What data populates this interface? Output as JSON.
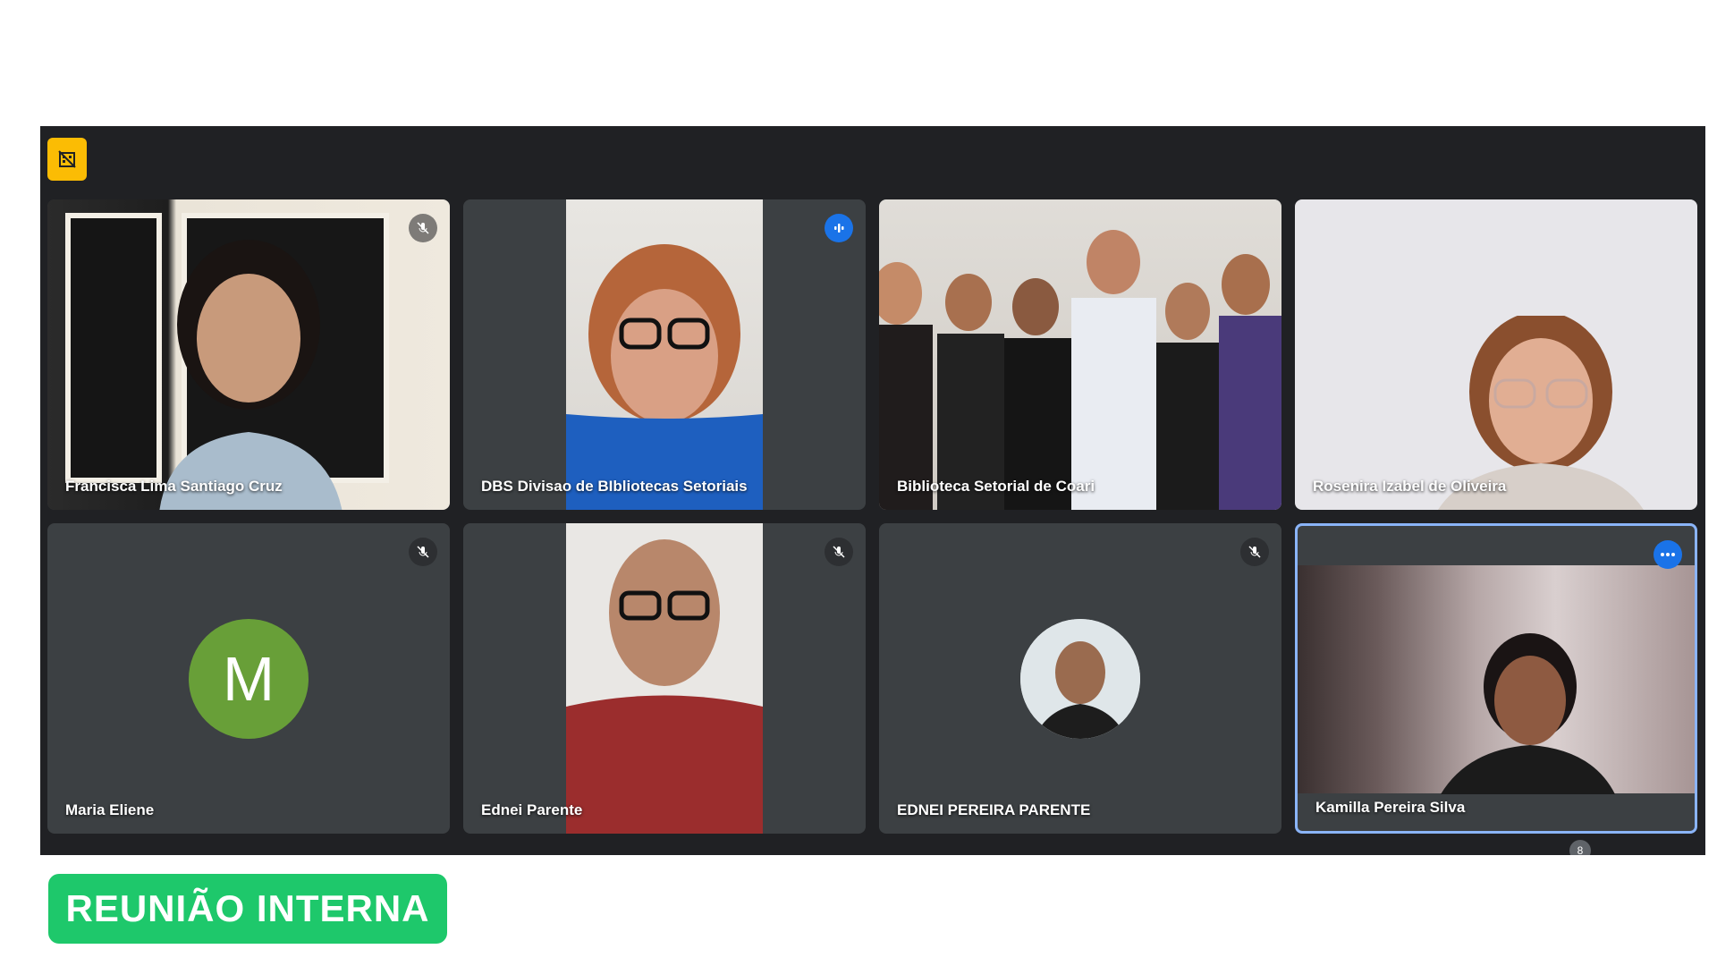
{
  "participant_count": "8",
  "banner": {
    "label": "REUNIÃO INTERNA",
    "color": "#1ec86b"
  },
  "accent": "#1a73e8",
  "participants": [
    {
      "name": "Francisca Lima Santiago Cruz",
      "status": "muted"
    },
    {
      "name": "DBS Divisao de BIbliotecas Setoriais",
      "status": "speaking"
    },
    {
      "name": "Biblioteca Setorial de Coari",
      "status": "none"
    },
    {
      "name": "Rosenira Izabel de Oliveira",
      "status": "none"
    },
    {
      "name": "Maria Eliene",
      "status": "muted",
      "avatar_letter": "M"
    },
    {
      "name": "Ednei Parente",
      "status": "muted"
    },
    {
      "name": "EDNEI PEREIRA PARENTE",
      "status": "muted"
    },
    {
      "name": "Kamilla Pereira Silva",
      "status": "more-options"
    }
  ]
}
